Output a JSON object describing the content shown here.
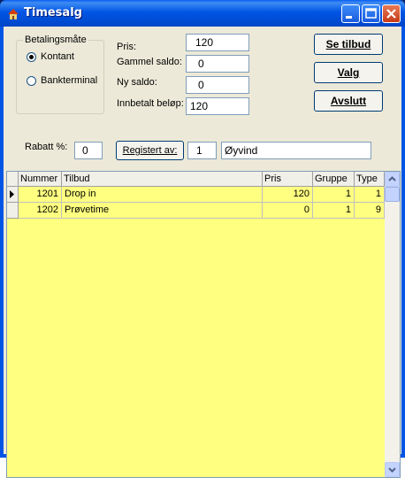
{
  "window": {
    "title": "Timesalg",
    "colors": {
      "titlebar": "#0055e5",
      "grid_background": "#ffff80",
      "client": "#ece9d8"
    }
  },
  "payment_method": {
    "legend": "Betalingsmåte",
    "options": [
      {
        "label": "Kontant",
        "selected": true
      },
      {
        "label": "Bankterminal",
        "selected": false
      }
    ]
  },
  "fields": {
    "pris_label": "Pris:",
    "pris_value": "120",
    "gammel_saldo_label": "Gammel saldo:",
    "gammel_saldo_value": "0",
    "ny_saldo_label": "Ny saldo:",
    "ny_saldo_value": "0",
    "innbetalt_label": "Innbetalt beløp:",
    "innbetalt_value": "120",
    "rabatt_label": "Rabatt %:",
    "rabatt_value": "0",
    "registrert_button": "Registert av:",
    "registrert_id": "1",
    "registrert_name": "Øyvind"
  },
  "buttons": {
    "se_tilbud": "Se tilbud",
    "valg": "Valg",
    "avslutt": "Avslutt"
  },
  "grid": {
    "columns": [
      "Nummer",
      "Tilbud",
      "Pris",
      "Gruppe",
      "Type"
    ],
    "rows": [
      {
        "nummer": "1201",
        "tilbud": "Drop in",
        "pris": "120",
        "gruppe": "1",
        "type": "1",
        "current": true
      },
      {
        "nummer": "1202",
        "tilbud": "Prøvetime",
        "pris": "0",
        "gruppe": "1",
        "type": "9",
        "current": false
      }
    ]
  },
  "icons": {
    "app": "app-icon",
    "minimize": "minimize-icon",
    "maximize": "maximize-icon",
    "close": "close-icon",
    "row_pointer": "row-pointer-icon",
    "scroll_up": "scroll-up-icon",
    "scroll_down": "scroll-down-icon"
  }
}
